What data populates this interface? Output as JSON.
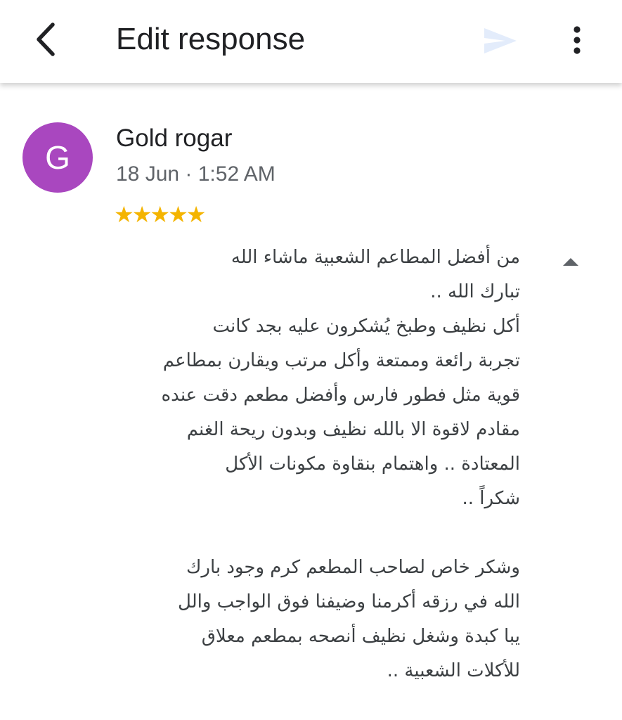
{
  "app_bar": {
    "title": "Edit response",
    "back_icon": "chevron-left-icon",
    "send_icon": "send-icon",
    "more_icon": "more-vert-icon",
    "send_color": "#e3ecfb"
  },
  "review": {
    "avatar_letter": "G",
    "avatar_color": "#a947bf",
    "reviewer_name": "Gold rogar",
    "date": "18 Jun · 1:52 AM",
    "rating": 5,
    "stars": "★★★★★",
    "star_color": "#f4b400",
    "collapse_icon": "caret-up-icon",
    "text": "من أفضل المطاعم الشعبية ماشاء الله\nتبارك الله ..\nأكل نظيف وطبخ يُشكرون عليه بجد كانت\nتجربة رائعة وممتعة وأكل مرتب ويقارن بمطاعم\nقوية مثل فطور فارس وأفضل مطعم دقت عنده\nمقادم لاقوة الا بالله نظيف وبدون ريحة الغنم\nالمعتادة .. واهتمام بنقاوة مكونات الأكل\nشكراً ..\n\nوشكر خاص لصاحب المطعم كرم وجود بارك\nالله في رزقه  أكرمنا وضيفنا فوق الواجب والل\nيبا كبدة وشغل نظيف أنصحه بمطعم معلاق\nللأكلات الشعبية .."
  }
}
